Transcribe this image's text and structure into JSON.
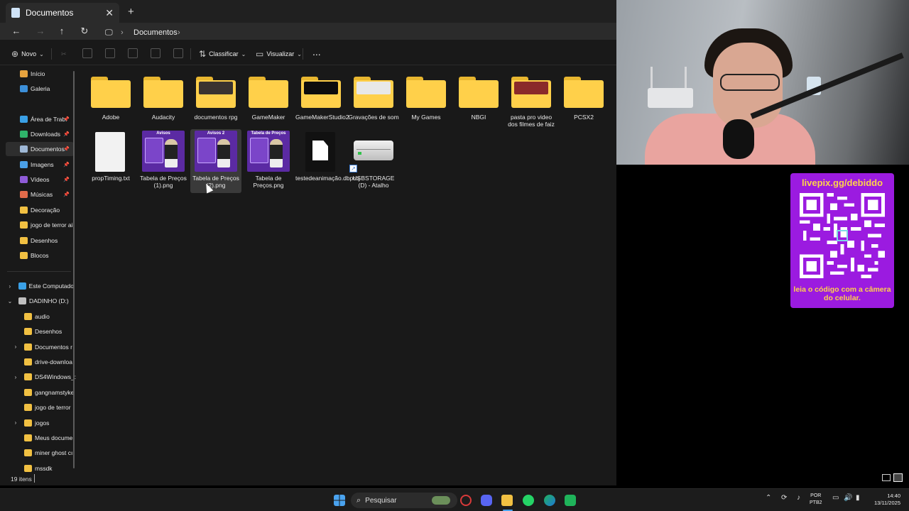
{
  "window": {
    "tab_title": "Documentos"
  },
  "navigation": {
    "breadcrumb": [
      "Documentos"
    ]
  },
  "toolbar": {
    "new_label": "Novo",
    "sort_label": "Classificar",
    "view_label": "Visualizar",
    "more_label": "..."
  },
  "sidebar": {
    "quick": [
      {
        "label": "Início",
        "icon": "home-icon",
        "color": "#e7a33e"
      },
      {
        "label": "Galeria",
        "icon": "gallery-icon",
        "color": "#3c8fd9"
      },
      {
        "label": "Área de Trab.",
        "icon": "desktop-icon",
        "color": "#3aa0e6",
        "pinned": true
      },
      {
        "label": "Downloads",
        "icon": "download-icon",
        "color": "#2fb36a",
        "pinned": true
      },
      {
        "label": "Documentos",
        "icon": "documents-icon",
        "color": "#9fb8d6",
        "pinned": true,
        "selected": true
      },
      {
        "label": "Imagens",
        "icon": "pictures-icon",
        "color": "#4aa0e8",
        "pinned": true
      },
      {
        "label": "Vídeos",
        "icon": "videos-icon",
        "color": "#8f5bd8",
        "pinned": true
      },
      {
        "label": "Músicas",
        "icon": "music-icon",
        "color": "#e26b4a",
        "pinned": true
      },
      {
        "label": "Decoração",
        "icon": "folder-icon",
        "color": "#f1c042"
      },
      {
        "label": "jogo de terror ai",
        "icon": "folder-icon",
        "color": "#f1c042"
      },
      {
        "label": "Desenhos",
        "icon": "folder-icon",
        "color": "#f1c042"
      },
      {
        "label": "Blocos",
        "icon": "folder-icon",
        "color": "#f1c042"
      }
    ],
    "tree": [
      {
        "label": "Este Computado",
        "icon": "computer-icon",
        "color": "#3aa0e6",
        "chevron": "›",
        "level": 0
      },
      {
        "label": "DADINHO (D:)",
        "icon": "drive-icon",
        "color": "#bfbfbf",
        "chevron": "⌄",
        "level": 0
      },
      {
        "label": "audio",
        "icon": "folder-icon",
        "color": "#f1c042",
        "chevron": "",
        "level": 1
      },
      {
        "label": "Desenhos",
        "icon": "folder-icon",
        "color": "#f1c042",
        "chevron": "",
        "level": 1
      },
      {
        "label": "Documentos r",
        "icon": "folder-icon",
        "color": "#f1c042",
        "chevron": "›",
        "level": 1
      },
      {
        "label": "drive-downloa",
        "icon": "folder-icon",
        "color": "#f1c042",
        "chevron": "",
        "level": 1
      },
      {
        "label": "DS4Windows_:",
        "icon": "folder-icon",
        "color": "#f1c042",
        "chevron": "›",
        "level": 1
      },
      {
        "label": "gangnamstyke",
        "icon": "folder-icon",
        "color": "#f1c042",
        "chevron": "",
        "level": 1
      },
      {
        "label": "jogo de terror",
        "icon": "folder-icon",
        "color": "#f1c042",
        "chevron": "",
        "level": 1
      },
      {
        "label": "jogos",
        "icon": "folder-icon",
        "color": "#f1c042",
        "chevron": "›",
        "level": 1
      },
      {
        "label": "Meus docume",
        "icon": "folder-icon",
        "color": "#f1c042",
        "chevron": "",
        "level": 1
      },
      {
        "label": "miner ghost cı",
        "icon": "folder-icon",
        "color": "#f1c042",
        "chevron": "",
        "level": 1
      },
      {
        "label": "mssdk",
        "icon": "folder-icon",
        "color": "#f1c042",
        "chevron": "",
        "level": 1
      }
    ]
  },
  "files": [
    {
      "label": "Adobe",
      "kind": "folder"
    },
    {
      "label": "Audacity",
      "kind": "folder"
    },
    {
      "label": "documentos rpg",
      "kind": "folder",
      "peek": "#3a3330"
    },
    {
      "label": "GameMaker",
      "kind": "folder"
    },
    {
      "label": "GameMakerStudio2",
      "kind": "folder",
      "peek": "#0d0d0d"
    },
    {
      "label": "Gravações de som",
      "kind": "folder",
      "peek": "#e8e8e8"
    },
    {
      "label": "My Games",
      "kind": "folder"
    },
    {
      "label": "NBGI",
      "kind": "folder"
    },
    {
      "label": "pasta pro video dos filmes de faiz",
      "kind": "folder",
      "peek": "#8a2a2a"
    },
    {
      "label": "PCSX2",
      "kind": "folder"
    },
    {
      "label": "propTiming.txt",
      "kind": "text"
    },
    {
      "label": "Tabela de Preços (1).png",
      "kind": "image",
      "thumb_title": "Avisos"
    },
    {
      "label": "Tabela de Preços (2).png",
      "kind": "image",
      "thumb_title": "Avisos 2",
      "selected": true
    },
    {
      "label": "Tabela de Preços.png",
      "kind": "image",
      "thumb_title": "Tabela de Preços"
    },
    {
      "label": "testedeanimação.dbproj",
      "kind": "project"
    },
    {
      "label": "USBSTORAGE (D) - Atalho",
      "kind": "shortcut"
    }
  ],
  "status": {
    "item_count": "19 itens"
  },
  "overlay": {
    "qr_title": "livepix.gg/debiddo",
    "qr_footer": "leia o código com a câmera do celular."
  },
  "taskbar": {
    "search_placeholder": "Pesquisar",
    "lang_line1": "POR",
    "lang_line2": "PTB2",
    "time": "14:40",
    "date": "13/11/2025"
  }
}
